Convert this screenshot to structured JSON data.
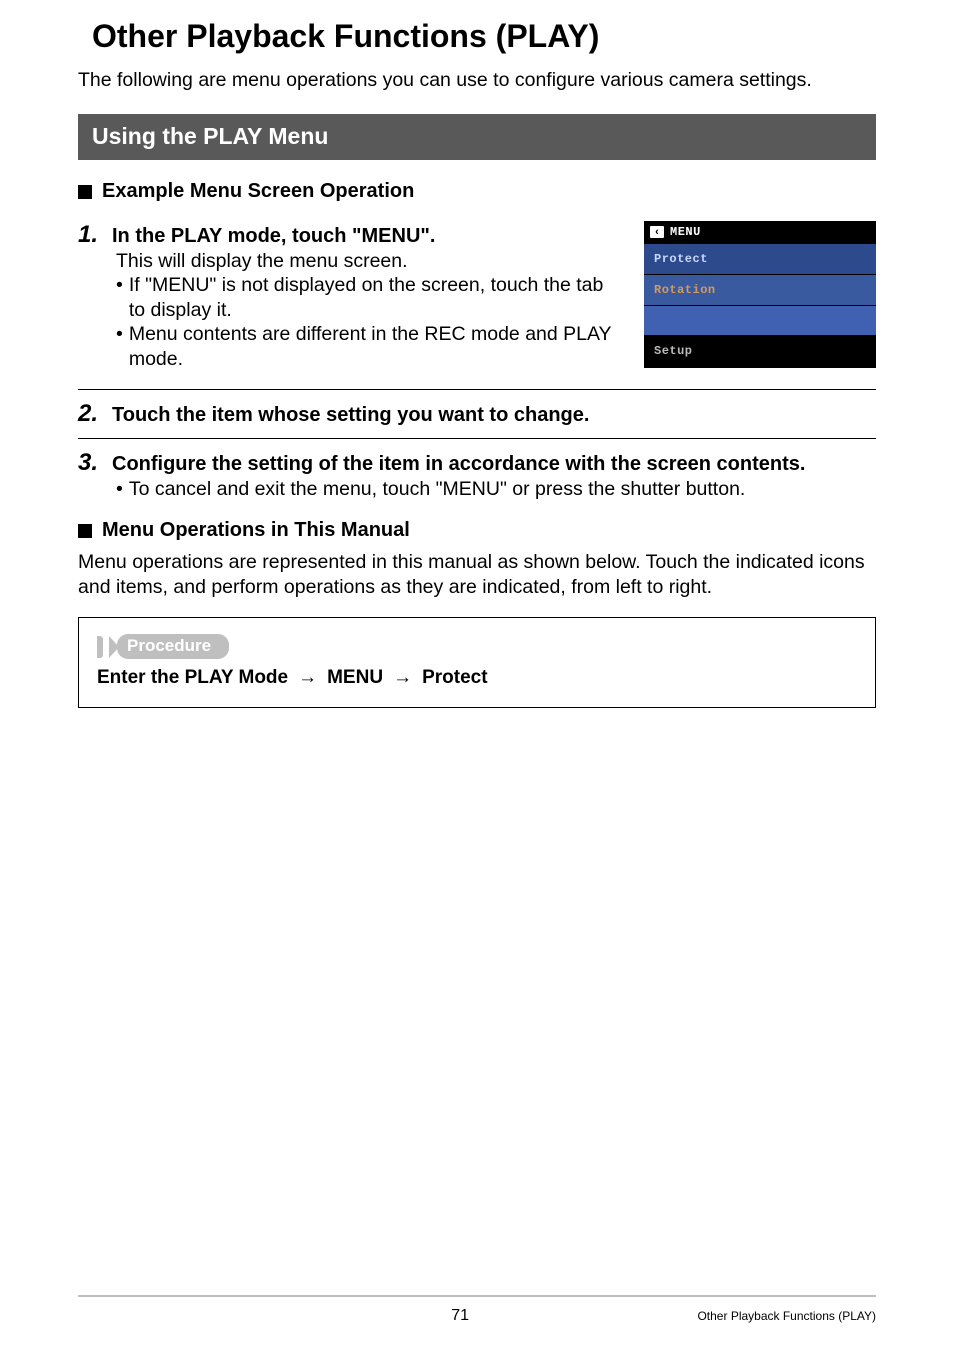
{
  "title": "Other Playback Functions (PLAY)",
  "intro": "The following are menu operations you can use to configure various camera settings.",
  "section_bar": "Using the PLAY Menu",
  "subhead1": "Example Menu Screen Operation",
  "steps": {
    "s1": {
      "num": "1.",
      "head": "In the PLAY mode, touch \"MENU\".",
      "body": "This will display the menu screen.",
      "bullets": [
        "If \"MENU\" is not displayed on the screen, touch the tab to display it.",
        "Menu contents are different in the REC mode and PLAY mode."
      ]
    },
    "s2": {
      "num": "2.",
      "head": "Touch the item whose setting you want to change."
    },
    "s3": {
      "num": "3.",
      "head": "Configure the setting of the item in accordance with the screen contents.",
      "bullets": [
        "To cancel and exit the menu, touch \"MENU\" or press the shutter button."
      ]
    }
  },
  "screenshot": {
    "back_glyph": "‹",
    "header": "MENU",
    "items": {
      "protect": "Protect",
      "rotation": "Rotation",
      "setup": "Setup"
    }
  },
  "subhead2": "Menu Operations in This Manual",
  "para2": "Menu operations are represented in this manual as shown below. Touch the indicated icons and items, and perform operations as they are indicated, from left to right.",
  "procedure": {
    "label": "Procedure",
    "parts": [
      "Enter the PLAY Mode",
      "MENU",
      "Protect"
    ]
  },
  "footer": {
    "page": "71",
    "label": "Other Playback Functions (PLAY)"
  }
}
